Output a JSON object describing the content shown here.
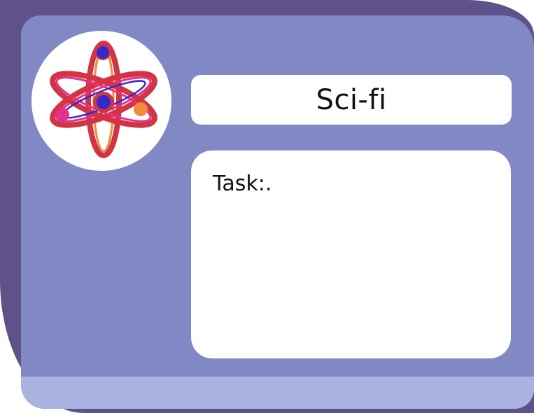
{
  "card": {
    "title": "Sci-fi",
    "task_label": "Task:.",
    "emblem_icon": "atom-icon"
  },
  "colors": {
    "card_back": "#5f518a",
    "card_front": "#8189c4",
    "card_footer": "#a8b4df",
    "panel": "#ffffff",
    "orbit_red": "#d13545",
    "orbit_pink": "#e6308a",
    "orbit_orange": "#f08a3c",
    "orbit_blue": "#3529c9"
  }
}
